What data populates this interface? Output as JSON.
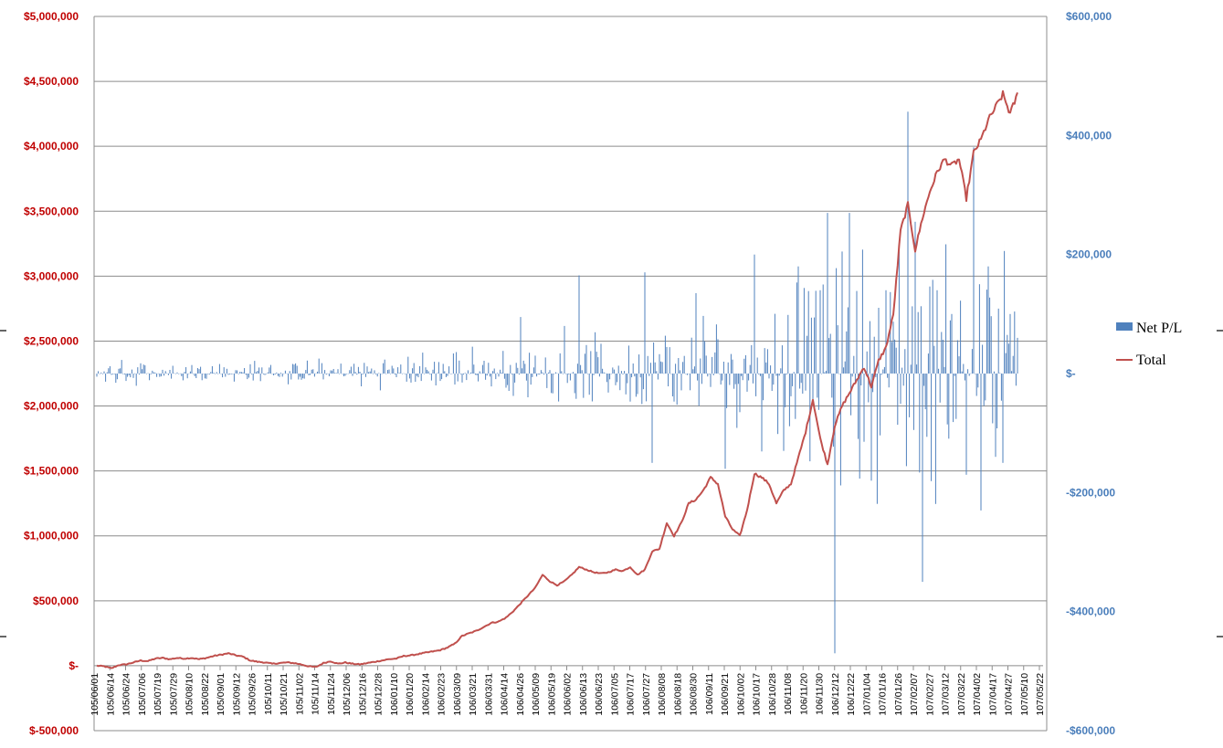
{
  "chart_data": {
    "type": "bar+line",
    "left_axis": {
      "min": -500000,
      "max": 5000000,
      "step": 500000,
      "tick_labels": [
        "$-500,000",
        "$-",
        "$500,000",
        "$1,000,000",
        "$1,500,000",
        "$2,000,000",
        "$2,500,000",
        "$3,000,000",
        "$3,500,000",
        "$4,000,000",
        "$4,500,000",
        "$5,000,000"
      ],
      "color": "#c00000"
    },
    "right_axis": {
      "min": -600000,
      "max": 600000,
      "step": 200000,
      "tick_labels": [
        "-$600,000",
        "-$400,000",
        "-$200,000",
        "$-",
        "$200,000",
        "$400,000",
        "$600,000"
      ],
      "color": "#4a7ebb"
    },
    "x_tick_labels": [
      "105/06/01",
      "105/06/14",
      "105/06/24",
      "105/07/06",
      "105/07/19",
      "105/07/29",
      "105/08/10",
      "105/08/22",
      "105/09/01",
      "105/09/12",
      "105/09/26",
      "105/10/11",
      "105/10/21",
      "105/11/02",
      "105/11/14",
      "105/11/24",
      "105/12/06",
      "105/12/16",
      "105/12/28",
      "106/01/10",
      "106/01/20",
      "106/02/14",
      "106/02/23",
      "106/03/09",
      "106/03/21",
      "106/03/31",
      "106/04/14",
      "106/04/26",
      "106/05/09",
      "106/05/19",
      "106/06/02",
      "106/06/13",
      "106/06/23",
      "106/07/05",
      "106/07/17",
      "106/07/27",
      "106/08/08",
      "106/08/18",
      "106/08/30",
      "106/09/11",
      "106/09/21",
      "106/10/02",
      "106/10/17",
      "106/10/28",
      "106/11/08",
      "106/11/20",
      "106/11/30",
      "106/12/12",
      "106/12/22",
      "107/01/04",
      "107/01/16",
      "107/01/26",
      "107/02/07",
      "107/02/27",
      "107/03/12",
      "107/03/22",
      "107/04/02",
      "107/04/17",
      "107/04/27",
      "107/05/10",
      "107/05/22"
    ],
    "grid": true,
    "legend": {
      "position": "right",
      "items": [
        {
          "name": "Net P/L",
          "kind": "bar",
          "color": "#4f81bd"
        },
        {
          "name": "Total",
          "kind": "line",
          "color": "#c0504d"
        }
      ]
    },
    "total_anchors": [
      [
        0,
        0
      ],
      [
        5,
        -5000
      ],
      [
        10,
        -20000
      ],
      [
        15,
        5000
      ],
      [
        20,
        10000
      ],
      [
        25,
        25000
      ],
      [
        30,
        40000
      ],
      [
        35,
        35000
      ],
      [
        40,
        55000
      ],
      [
        45,
        60000
      ],
      [
        50,
        50000
      ],
      [
        55,
        60000
      ],
      [
        60,
        55000
      ],
      [
        65,
        60000
      ],
      [
        70,
        50000
      ],
      [
        75,
        60000
      ],
      [
        80,
        75000
      ],
      [
        85,
        85000
      ],
      [
        90,
        95000
      ],
      [
        95,
        80000
      ],
      [
        100,
        70000
      ],
      [
        105,
        40000
      ],
      [
        110,
        30000
      ],
      [
        115,
        25000
      ],
      [
        120,
        15000
      ],
      [
        125,
        20000
      ],
      [
        130,
        25000
      ],
      [
        135,
        20000
      ],
      [
        140,
        10000
      ],
      [
        145,
        -5000
      ],
      [
        150,
        -10000
      ],
      [
        155,
        20000
      ],
      [
        160,
        35000
      ],
      [
        165,
        15000
      ],
      [
        170,
        25000
      ],
      [
        175,
        15000
      ],
      [
        180,
        10000
      ],
      [
        185,
        20000
      ],
      [
        190,
        30000
      ],
      [
        195,
        40000
      ],
      [
        200,
        50000
      ],
      [
        205,
        55000
      ],
      [
        210,
        75000
      ],
      [
        215,
        80000
      ],
      [
        220,
        90000
      ],
      [
        225,
        100000
      ],
      [
        230,
        110000
      ],
      [
        235,
        120000
      ],
      [
        240,
        140000
      ],
      [
        245,
        170000
      ],
      [
        250,
        230000
      ],
      [
        255,
        250000
      ],
      [
        260,
        270000
      ],
      [
        265,
        300000
      ],
      [
        270,
        330000
      ],
      [
        275,
        340000
      ],
      [
        280,
        370000
      ],
      [
        285,
        420000
      ],
      [
        290,
        480000
      ],
      [
        295,
        540000
      ],
      [
        300,
        600000
      ],
      [
        305,
        700000
      ],
      [
        310,
        650000
      ],
      [
        315,
        620000
      ],
      [
        320,
        650000
      ],
      [
        325,
        700000
      ],
      [
        330,
        760000
      ],
      [
        335,
        740000
      ],
      [
        340,
        720000
      ],
      [
        345,
        710000
      ],
      [
        350,
        720000
      ],
      [
        355,
        740000
      ],
      [
        360,
        730000
      ],
      [
        365,
        760000
      ],
      [
        370,
        700000
      ],
      [
        375,
        740000
      ],
      [
        380,
        880000
      ],
      [
        385,
        900000
      ],
      [
        390,
        1100000
      ],
      [
        395,
        1000000
      ],
      [
        400,
        1100000
      ],
      [
        405,
        1250000
      ],
      [
        410,
        1280000
      ],
      [
        415,
        1350000
      ],
      [
        420,
        1450000
      ],
      [
        425,
        1400000
      ],
      [
        430,
        1150000
      ],
      [
        435,
        1050000
      ],
      [
        440,
        1000000
      ],
      [
        445,
        1200000
      ],
      [
        450,
        1480000
      ],
      [
        455,
        1450000
      ],
      [
        460,
        1400000
      ],
      [
        465,
        1250000
      ],
      [
        470,
        1350000
      ],
      [
        475,
        1400000
      ],
      [
        480,
        1600000
      ],
      [
        485,
        1800000
      ],
      [
        490,
        2050000
      ],
      [
        495,
        1750000
      ],
      [
        500,
        1550000
      ],
      [
        505,
        1850000
      ],
      [
        510,
        2000000
      ],
      [
        515,
        2100000
      ],
      [
        520,
        2200000
      ],
      [
        525,
        2300000
      ],
      [
        530,
        2150000
      ],
      [
        535,
        2350000
      ],
      [
        540,
        2450000
      ],
      [
        545,
        2700000
      ],
      [
        550,
        3350000
      ],
      [
        555,
        3550000
      ],
      [
        560,
        3200000
      ],
      [
        565,
        3450000
      ],
      [
        570,
        3650000
      ],
      [
        575,
        3800000
      ],
      [
        580,
        3900000
      ],
      [
        585,
        3850000
      ],
      [
        590,
        3900000
      ],
      [
        595,
        3600000
      ],
      [
        600,
        3950000
      ],
      [
        605,
        4050000
      ],
      [
        610,
        4200000
      ],
      [
        615,
        4300000
      ],
      [
        620,
        4400000
      ],
      [
        625,
        4250000
      ],
      [
        630,
        4400000
      ]
    ],
    "net_pl_envelope": [
      [
        0,
        25000
      ],
      [
        150,
        25000
      ],
      [
        250,
        45000
      ],
      [
        360,
        70000
      ],
      [
        420,
        110000
      ],
      [
        470,
        180000
      ],
      [
        520,
        250000
      ],
      [
        560,
        300000
      ],
      [
        630,
        220000
      ]
    ],
    "net_pl_spikes": [
      [
        290,
        95000
      ],
      [
        320,
        80000
      ],
      [
        330,
        165000
      ],
      [
        345,
        50000
      ],
      [
        375,
        170000
      ],
      [
        380,
        -150000
      ],
      [
        410,
        135000
      ],
      [
        430,
        -160000
      ],
      [
        450,
        200000
      ],
      [
        470,
        -130000
      ],
      [
        480,
        180000
      ],
      [
        490,
        -50000
      ],
      [
        495,
        140000
      ],
      [
        500,
        270000
      ],
      [
        505,
        -470000
      ],
      [
        510,
        205000
      ],
      [
        515,
        270000
      ],
      [
        530,
        -180000
      ],
      [
        540,
        140000
      ],
      [
        555,
        440000
      ],
      [
        560,
        255000
      ],
      [
        565,
        -350000
      ],
      [
        575,
        140000
      ],
      [
        585,
        100000
      ],
      [
        595,
        -170000
      ],
      [
        600,
        380000
      ],
      [
        605,
        -230000
      ],
      [
        610,
        180000
      ],
      [
        615,
        -140000
      ],
      [
        620,
        -150000
      ],
      [
        625,
        100000
      ],
      [
        630,
        60000
      ]
    ]
  }
}
